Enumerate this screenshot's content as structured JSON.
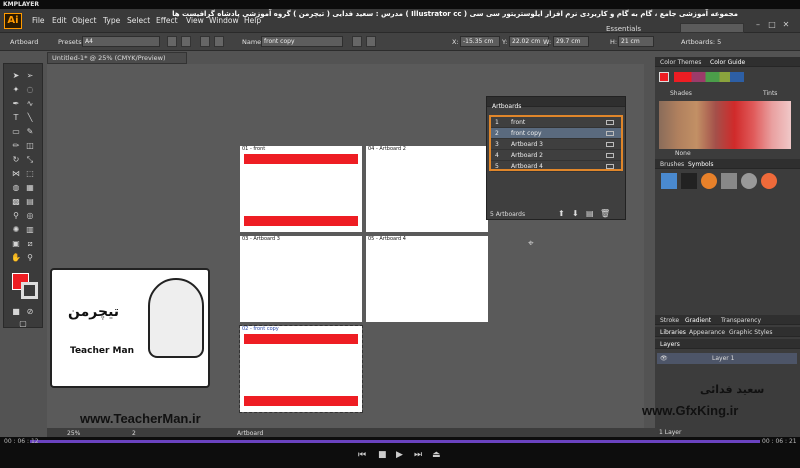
{
  "kmplayer": {
    "logo": "KMPLAYER",
    "time_current": "00 : 06 : 12",
    "time_total": "00 : 06 : 21"
  },
  "title_rtl": "مجموعه آموزشی جامع ، گام به گام و کاربردی نرم افزار ایلوستریتور سی سی ( Illustrator cc )  مدرس : سعید فدایی ( تیچرمن ) گروه آموزشی پادشاه گرافیست ها",
  "menu": [
    "File",
    "Edit",
    "Object",
    "Type",
    "Select",
    "Effect",
    "View",
    "Window",
    "Help"
  ],
  "workspace": "Essentials",
  "controlbar": {
    "tool": "Artboard",
    "presets_label": "Presets:",
    "presets_value": "A4",
    "name_label": "Name:",
    "name_value": "front copy",
    "x_label": "X:",
    "x_value": "-15.35 cm",
    "y_label": "Y:",
    "y_value": "22.02 cm",
    "w_label": "W:",
    "w_value": "29.7 cm",
    "h_label": "H:",
    "h_value": "21 cm",
    "artboards_label": "Artboards: 5"
  },
  "document_tab": "Untitled-1* @ 25% (CMYK/Preview)",
  "artboards": [
    {
      "label": "01 - front"
    },
    {
      "label": "04 - Artboard 2"
    },
    {
      "label": "03 - Artboard 3"
    },
    {
      "label": "05 - Artboard 4"
    },
    {
      "label": "02 - front copy"
    }
  ],
  "artboards_panel": {
    "title": "Artboards",
    "rows": [
      {
        "num": "1",
        "name": "front"
      },
      {
        "num": "2",
        "name": "front copy"
      },
      {
        "num": "3",
        "name": "Artboard 3"
      },
      {
        "num": "4",
        "name": "Artboard 2"
      },
      {
        "num": "5",
        "name": "Artboard 4"
      }
    ],
    "footer": "5 Artboards"
  },
  "color_panel": {
    "tab1": "Color Themes",
    "tab2": "Color Guide",
    "shades": "Shades",
    "tints": "Tints",
    "none": "None"
  },
  "brushes_panel": {
    "tab1": "Brushes",
    "tab2": "Symbols"
  },
  "stroke_panel": {
    "tab1": "Stroke",
    "tab2": "Gradient",
    "tab3": "Transparency"
  },
  "libs_panel": {
    "tab1": "Libraries",
    "tab2": "Appearance",
    "tab3": "Graphic Styles"
  },
  "layers_panel": {
    "title": "Layers",
    "layer_name": "Layer 1",
    "footer": "1 Layer"
  },
  "statusbar": {
    "zoom": "25%",
    "page": "2",
    "tool": "Artboard"
  },
  "watermark": {
    "teacher_site": "www.TeacherMan.ir",
    "gfx_site": "www.GfxKing.ir",
    "teacher_name_fa": "سعید فدائی",
    "card_en": "Teacher Man",
    "card_fa": "تیچرمن"
  },
  "colors": {
    "accent_red": "#ee1d23",
    "panel_orange": "#e0862a",
    "progress": "#6a43c0"
  }
}
